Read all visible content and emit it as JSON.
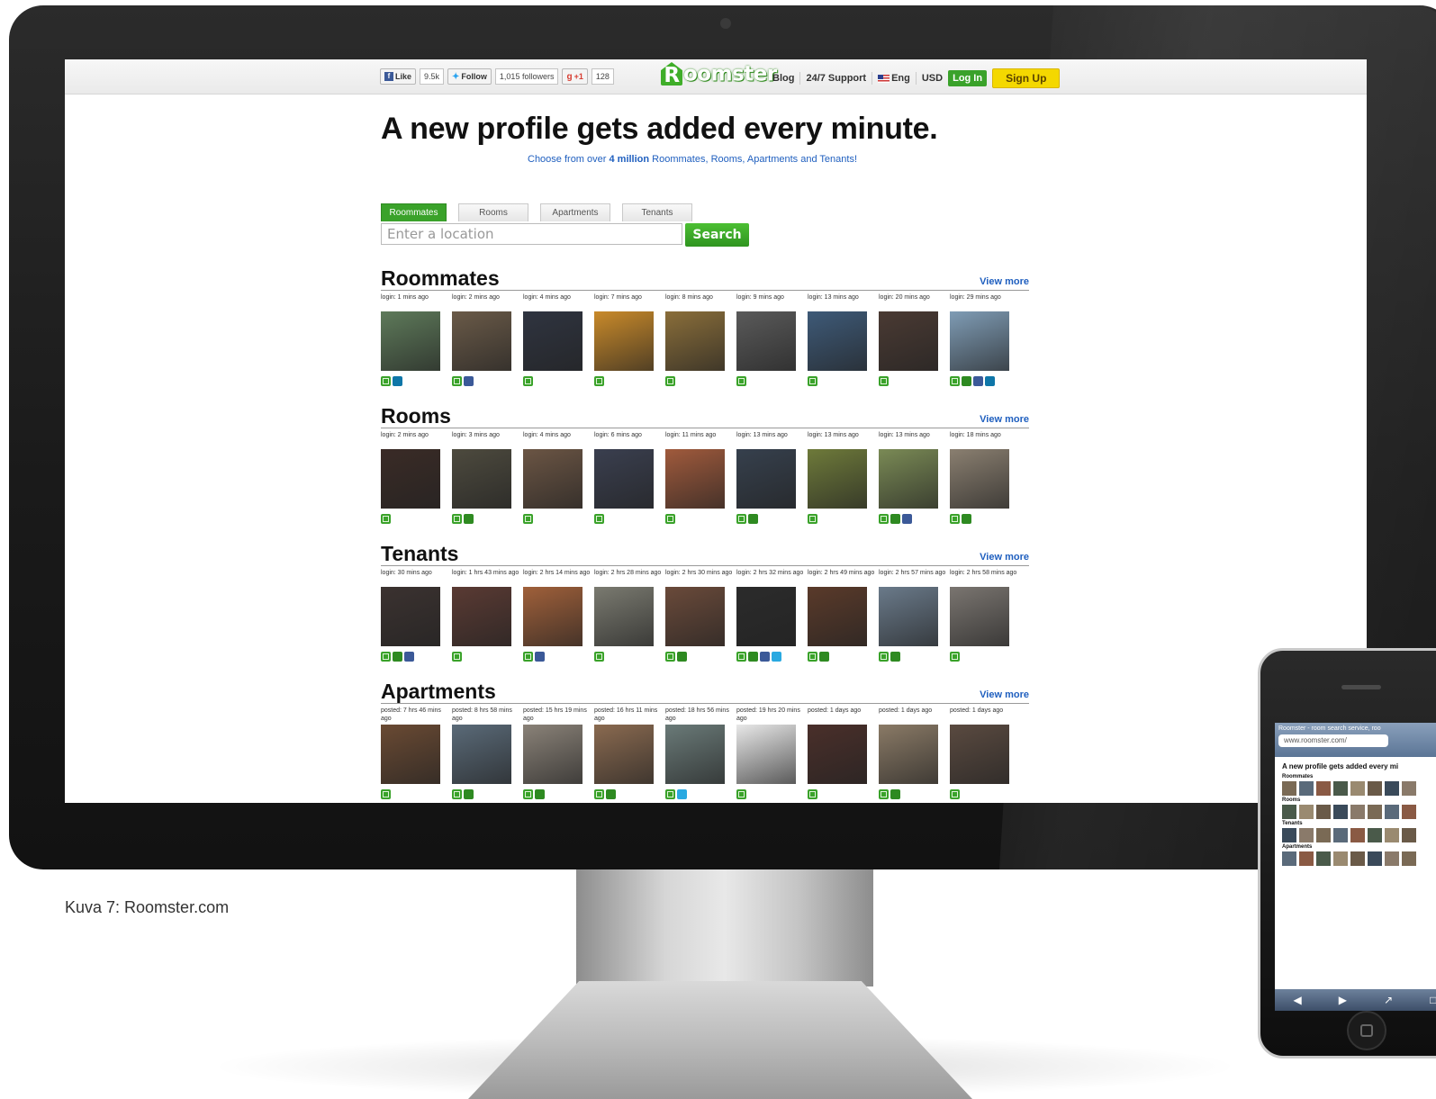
{
  "caption": "Kuva 7: Roomster.com",
  "colors": {
    "brand_green": "#3aa22a",
    "link_blue": "#1f5fbf",
    "signup_yellow": "#f4d800"
  },
  "topbar": {
    "social": {
      "like_label": "Like",
      "like_count": "9.5k",
      "follow_label": "Follow",
      "followers": "1,015 followers",
      "gplus_label": "+1",
      "gplus_count": "128"
    },
    "logo_first": "R",
    "logo_rest": "oomster",
    "nav": {
      "blog": "Blog",
      "support": "24/7 Support",
      "lang": "Eng",
      "currency": "USD",
      "login": "Log In",
      "signup": "Sign Up"
    }
  },
  "hero": {
    "headline": "A new profile gets added every minute.",
    "sub_pre": "Choose from over ",
    "sub_bold": "4 million",
    "sub_post": " Roommates, Rooms, Apartments and Tenants!"
  },
  "search": {
    "tabs": [
      "Roommates",
      "Rooms",
      "Apartments",
      "Tenants"
    ],
    "placeholder": "Enter a location",
    "button": "Search"
  },
  "sections": [
    {
      "title": "Roommates",
      "view_more": "View more",
      "cards": [
        {
          "label": "login: 1 mins ago",
          "icons": [
            "msg",
            "in"
          ],
          "color": "#5e7a5a"
        },
        {
          "label": "login: 2 mins ago",
          "icons": [
            "msg",
            "fb"
          ],
          "color": "#6a5a48"
        },
        {
          "label": "login: 4 mins ago",
          "icons": [
            "msg"
          ],
          "color": "#2f3440"
        },
        {
          "label": "login: 7 mins ago",
          "icons": [
            "msg"
          ],
          "color": "#c98a2a"
        },
        {
          "label": "login: 8 mins ago",
          "icons": [
            "msg"
          ],
          "color": "#8a6e3a"
        },
        {
          "label": "login: 9 mins ago",
          "icons": [
            "msg"
          ],
          "color": "#5a5a5a"
        },
        {
          "label": "login: 13 mins ago",
          "icons": [
            "msg"
          ],
          "color": "#3e5a78"
        },
        {
          "label": "login: 20 mins ago",
          "icons": [
            "msg"
          ],
          "color": "#4a3a33"
        },
        {
          "label": "login: 29 mins ago",
          "icons": [
            "msg",
            "phone",
            "fb",
            "in"
          ],
          "color": "#7f9cb5"
        }
      ]
    },
    {
      "title": "Rooms",
      "view_more": "View more",
      "cards": [
        {
          "label": "login: 2 mins ago",
          "icons": [
            "msg"
          ],
          "color": "#3a2b26"
        },
        {
          "label": "login: 3 mins ago",
          "icons": [
            "msg",
            "phone"
          ],
          "color": "#4d4a3e"
        },
        {
          "label": "login: 4 mins ago",
          "icons": [
            "msg"
          ],
          "color": "#6b5544"
        },
        {
          "label": "login: 6 mins ago",
          "icons": [
            "msg"
          ],
          "color": "#3a3f4f"
        },
        {
          "label": "login: 11 mins ago",
          "icons": [
            "msg"
          ],
          "color": "#a05a3c"
        },
        {
          "label": "login: 13 mins ago",
          "icons": [
            "msg",
            "phone"
          ],
          "color": "#36404d"
        },
        {
          "label": "login: 13 mins ago",
          "icons": [
            "msg"
          ],
          "color": "#6e7a3a"
        },
        {
          "label": "login: 13 mins ago",
          "icons": [
            "msg",
            "phone",
            "fb"
          ],
          "color": "#7a8a55"
        },
        {
          "label": "login: 18 mins ago",
          "icons": [
            "msg",
            "phone"
          ],
          "color": "#8a7f70"
        }
      ]
    },
    {
      "title": "Tenants",
      "view_more": "View more",
      "cards": [
        {
          "label": "login: 30 mins ago",
          "icons": [
            "msg",
            "phone",
            "fb"
          ],
          "color": "#3b3230"
        },
        {
          "label": "login: 1 hrs 43 mins ago",
          "icons": [
            "msg"
          ],
          "color": "#5a3a33"
        },
        {
          "label": "login: 2 hrs 14 mins ago",
          "icons": [
            "msg",
            "fb"
          ],
          "color": "#a0603a"
        },
        {
          "label": "login: 2 hrs 28 mins ago",
          "icons": [
            "msg"
          ],
          "color": "#7a7a70"
        },
        {
          "label": "login: 2 hrs 30 mins ago",
          "icons": [
            "msg",
            "phone"
          ],
          "color": "#6a4a3a"
        },
        {
          "label": "login: 2 hrs 32 mins ago",
          "icons": [
            "msg",
            "phone",
            "fb",
            "tw"
          ],
          "color": "#2b2b2b"
        },
        {
          "label": "login: 2 hrs 49 mins ago",
          "icons": [
            "msg",
            "phone"
          ],
          "color": "#5a3a2a"
        },
        {
          "label": "login: 2 hrs 57 mins ago",
          "icons": [
            "msg",
            "phone"
          ],
          "color": "#6a7a8a"
        },
        {
          "label": "login: 2 hrs 58 mins ago",
          "icons": [
            "msg"
          ],
          "color": "#7a7570"
        }
      ]
    },
    {
      "title": "Apartments",
      "view_more": "View more",
      "cards": [
        {
          "label": "posted: 7 hrs 46 mins ago",
          "icons": [
            "msg"
          ],
          "color": "#6a4a33"
        },
        {
          "label": "posted: 8 hrs 58 mins ago",
          "icons": [
            "msg",
            "phone"
          ],
          "color": "#5a6a78"
        },
        {
          "label": "posted: 15 hrs 19 mins ago",
          "icons": [
            "msg",
            "phone"
          ],
          "color": "#8a8278"
        },
        {
          "label": "posted: 16 hrs 11 mins ago",
          "icons": [
            "msg",
            "phone"
          ],
          "color": "#8a6a50"
        },
        {
          "label": "posted: 18 hrs 56 mins ago",
          "icons": [
            "msg",
            "tw"
          ],
          "color": "#6a7a78"
        },
        {
          "label": "posted: 19 hrs 20 mins ago",
          "icons": [
            "msg"
          ],
          "color": "#e8e8e8"
        },
        {
          "label": "posted: 1 days ago",
          "icons": [
            "msg"
          ],
          "color": "#4a2f2a"
        },
        {
          "label": "posted: 1 days ago",
          "icons": [
            "msg",
            "phone"
          ],
          "color": "#8a7a66"
        },
        {
          "label": "posted: 1 days ago",
          "icons": [
            "msg"
          ],
          "color": "#5a4a40"
        }
      ]
    }
  ],
  "phone": {
    "tab_title": "Roomster - room search service, roo",
    "url": "www.roomster.com/",
    "headline": "A new profile gets added every mi",
    "sections": [
      "Roommates",
      "Rooms",
      "Tenants",
      "Apartments"
    ]
  }
}
